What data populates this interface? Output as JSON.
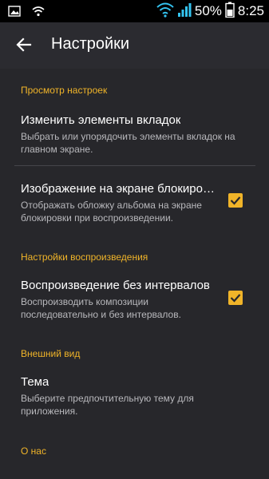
{
  "status_bar": {
    "battery_percent": "50%",
    "time": "8:25",
    "icons": [
      "gallery-icon",
      "wifi-icon",
      "wifi-signal-icon",
      "cell-signal-icon",
      "battery-icon"
    ]
  },
  "app_bar": {
    "back_icon": "back-arrow-icon",
    "title": "Настройки"
  },
  "sections": {
    "view": {
      "header": "Просмотр настроек",
      "tabs_item": {
        "title": "Изменить элементы вкладок",
        "subtitle_line1": "Выбрать или упорядочить элементы вкладок на",
        "subtitle_line2": "главном экране."
      },
      "lockscreen_item": {
        "title": "Изображение на экране блокиров…",
        "subtitle_line1": "Отображать обложку альбома на экране",
        "subtitle_line2": "блокировки при воспроизведении.",
        "checked": true
      }
    },
    "playback": {
      "header": "Настройки воспроизведения",
      "gapless_item": {
        "title": "Воспроизведение без интервалов",
        "subtitle_line1": "Воспроизводить композиции",
        "subtitle_line2": "последовательно и без интервалов.",
        "checked": true
      }
    },
    "appearance": {
      "header": "Внешний вид",
      "theme_item": {
        "title": "Тема",
        "subtitle_line1": "Выберите предпочтительную тему для",
        "subtitle_line2": "приложения."
      }
    },
    "about": {
      "header": "О нас"
    }
  },
  "colors": {
    "accent": "#f0b429",
    "background": "#27272b",
    "status_bar": "#000000"
  }
}
